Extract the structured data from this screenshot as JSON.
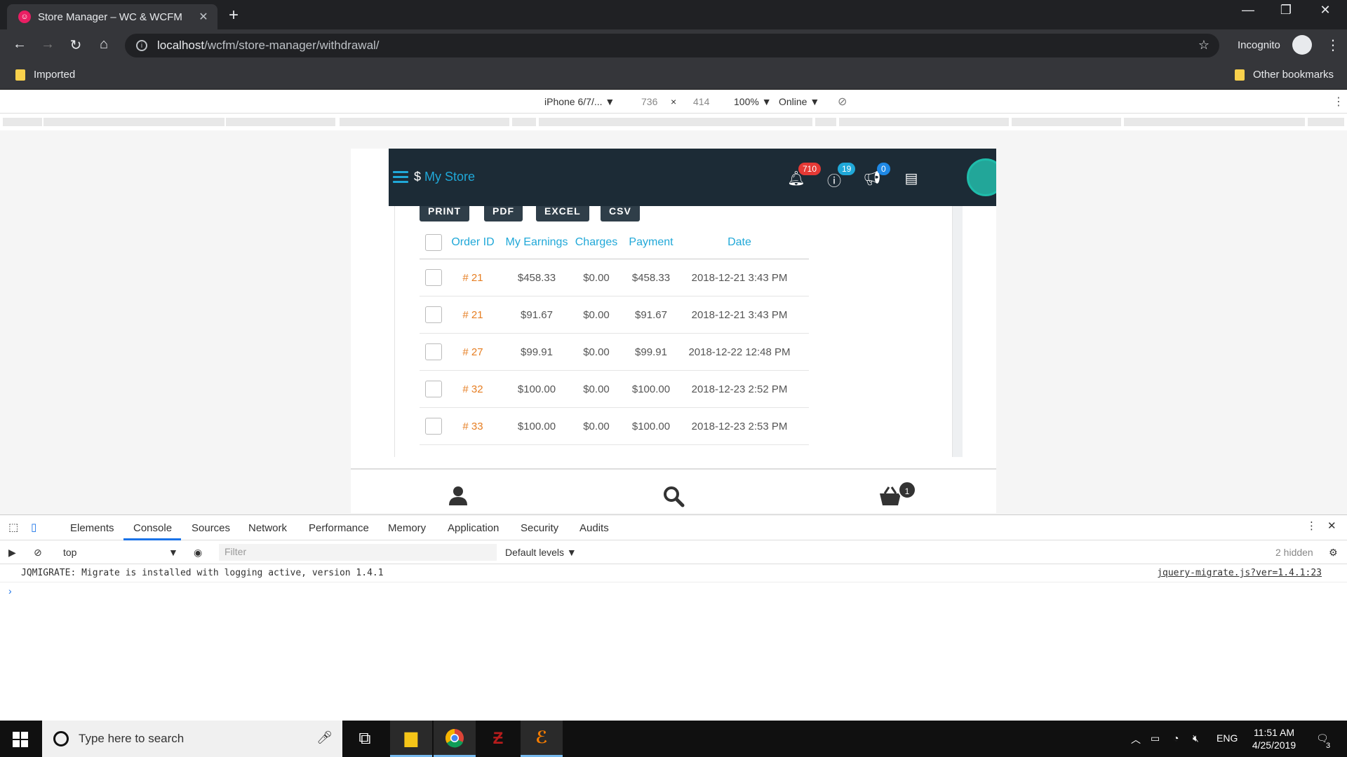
{
  "browser": {
    "tab_title": "Store Manager – WC & WCFM",
    "url_host": "localhost",
    "url_path": "/wcfm/store-manager/withdrawal/",
    "incognito_label": "Incognito",
    "bookmarks": [
      {
        "label": "Imported"
      },
      {
        "label": "Other bookmarks"
      }
    ]
  },
  "device_toolbar": {
    "device": "iPhone 6/7/... ▼",
    "width": "736",
    "times": "×",
    "height": "414",
    "zoom": "100% ▼",
    "network": "Online ▼"
  },
  "app": {
    "store_dollar": "$",
    "store_name": "My Store",
    "badges": {
      "notifications": "710",
      "help": "19",
      "announcements": "0"
    },
    "export_buttons": [
      "PRINT",
      "PDF",
      "EXCEL",
      "CSV"
    ],
    "table": {
      "headers": [
        "Order ID",
        "My Earnings",
        "Charges",
        "Payment",
        "Date"
      ],
      "rows": [
        {
          "id": "# 21",
          "earnings": "$458.33",
          "charges": "$0.00",
          "payment": "$458.33",
          "date": "2018-12-21 3:43 PM"
        },
        {
          "id": "# 21",
          "earnings": "$91.67",
          "charges": "$0.00",
          "payment": "$91.67",
          "date": "2018-12-21 3:43 PM"
        },
        {
          "id": "# 27",
          "earnings": "$99.91",
          "charges": "$0.00",
          "payment": "$99.91",
          "date": "2018-12-22 12:48 PM"
        },
        {
          "id": "# 32",
          "earnings": "$100.00",
          "charges": "$0.00",
          "payment": "$100.00",
          "date": "2018-12-23 2:52 PM"
        },
        {
          "id": "# 33",
          "earnings": "$100.00",
          "charges": "$0.00",
          "payment": "$100.00",
          "date": "2018-12-23 2:53 PM"
        }
      ]
    },
    "cart_count": "1"
  },
  "devtools": {
    "tabs": [
      "Elements",
      "Console",
      "Sources",
      "Network",
      "Performance",
      "Memory",
      "Application",
      "Security",
      "Audits"
    ],
    "context": "top",
    "filter_placeholder": "Filter",
    "levels": "Default levels ▼",
    "hidden": "2 hidden",
    "log_message": "JQMIGRATE: Migrate is installed with logging active, version 1.4.1",
    "log_source": "jquery-migrate.js?ver=1.4.1:23"
  },
  "taskbar": {
    "search_placeholder": "Type here to search",
    "language": "ENG",
    "time": "11:51 AM",
    "date": "4/25/2019",
    "notifications": "3"
  }
}
